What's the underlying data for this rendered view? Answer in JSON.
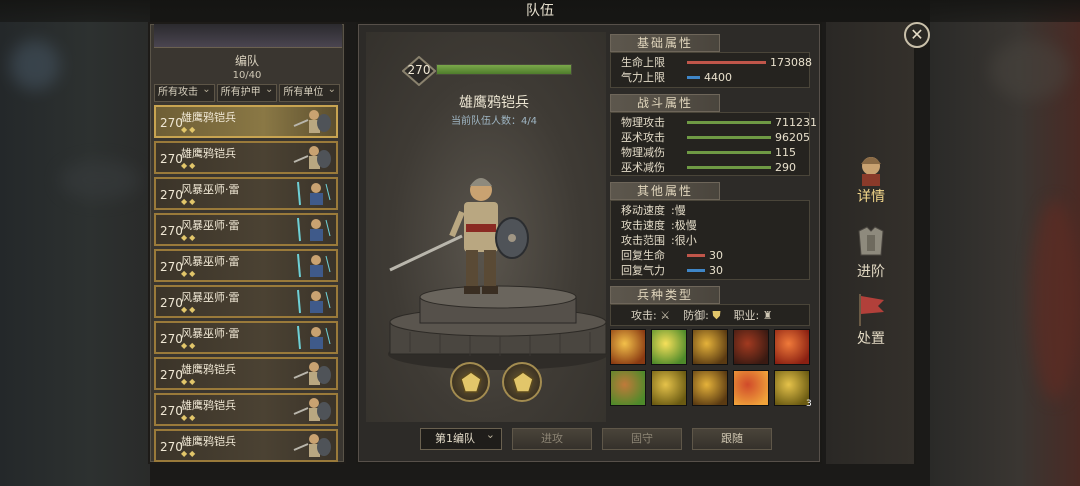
{
  "window": {
    "title": "队伍"
  },
  "roster": {
    "title": "编队",
    "count": "10/40",
    "filters": [
      "所有攻击",
      "所有护甲",
      "所有单位"
    ],
    "units": [
      {
        "level": "270",
        "name": "雄鹰鸦铠兵",
        "stars": "◆◆",
        "type": "shield",
        "selected": true
      },
      {
        "level": "270",
        "name": "雄鹰鸦铠兵",
        "stars": "◆◆",
        "type": "shield",
        "selected": false
      },
      {
        "level": "270",
        "name": "风暴巫师·雷",
        "stars": "◆◆",
        "type": "mage",
        "selected": false
      },
      {
        "level": "270",
        "name": "风暴巫师·雷",
        "stars": "◆◆",
        "type": "mage",
        "selected": false
      },
      {
        "level": "270",
        "name": "风暴巫师·雷",
        "stars": "◆◆",
        "type": "mage",
        "selected": false
      },
      {
        "level": "270",
        "name": "风暴巫师·雷",
        "stars": "◆◆",
        "type": "mage",
        "selected": false
      },
      {
        "level": "270",
        "name": "风暴巫师·雷",
        "stars": "◆◆",
        "type": "mage",
        "selected": false
      },
      {
        "level": "270",
        "name": "雄鹰鸦铠兵",
        "stars": "◆◆",
        "type": "shield",
        "selected": false
      },
      {
        "level": "270",
        "name": "雄鹰鸦铠兵",
        "stars": "◆◆",
        "type": "shield",
        "selected": false
      },
      {
        "level": "270",
        "name": "雄鹰鸦铠兵",
        "stars": "◆◆",
        "type": "shield",
        "selected": false
      }
    ]
  },
  "unit": {
    "level": "270",
    "name": "雄鹰鸦铠兵",
    "squad_count": "当前队伍人数：4/4",
    "exp_fraction": 1.0
  },
  "attributes": {
    "basic": {
      "title": "基础属性",
      "rows": [
        {
          "label": "生命上限",
          "value": "173088",
          "bar_color": "#c0564a",
          "fraction": 0.9
        },
        {
          "label": "气力上限",
          "value": "4400",
          "bar_color": "#3f86c7",
          "fraction": 0.15
        }
      ]
    },
    "combat": {
      "title": "战斗属性",
      "rows": [
        {
          "label": "物理攻击",
          "value": "711231",
          "bar_color": "#6f9a44",
          "fraction": 0.95
        },
        {
          "label": "巫术攻击",
          "value": "96205",
          "bar_color": "#6f9a44",
          "fraction": 0.95
        },
        {
          "label": "物理减伤",
          "value": "115",
          "bar_color": "#6f9a44",
          "fraction": 0.95
        },
        {
          "label": "巫术减伤",
          "value": "290",
          "bar_color": "#6f9a44",
          "fraction": 0.95
        }
      ]
    },
    "other": {
      "title": "其他属性",
      "rows": [
        {
          "label": "移动速度",
          "value": ":慢"
        },
        {
          "label": "攻击速度",
          "value": ":极慢"
        },
        {
          "label": "攻击范围",
          "value": ":很小"
        },
        {
          "label": "回复生命",
          "value": "30",
          "bar_color": "#c0564a",
          "fraction": 0.2
        },
        {
          "label": "回复气力",
          "value": "30",
          "bar_color": "#3f86c7",
          "fraction": 0.2
        }
      ]
    },
    "troop_type": {
      "title": "兵种类型",
      "attack_label": "攻击:",
      "defense_label": "防御:",
      "class_label": "职业:"
    }
  },
  "skills": [
    {
      "name": "skill-1",
      "colors": [
        "#f3c04a",
        "#8a3a12"
      ]
    },
    {
      "name": "skill-2",
      "colors": [
        "#f6e05a",
        "#4e8a2a"
      ]
    },
    {
      "name": "skill-3",
      "colors": [
        "#e5b23a",
        "#5a3a12"
      ]
    },
    {
      "name": "skill-4",
      "colors": [
        "#a23a20",
        "#3a1a12"
      ]
    },
    {
      "name": "skill-5",
      "colors": [
        "#f07a3a",
        "#8a2012"
      ]
    },
    {
      "name": "skill-6",
      "colors": [
        "#c07a3a",
        "#4e8a2a"
      ]
    },
    {
      "name": "skill-7",
      "colors": [
        "#e5c24a",
        "#6a5a12"
      ]
    },
    {
      "name": "skill-8",
      "colors": [
        "#e5b23a",
        "#5a3a12"
      ]
    },
    {
      "name": "skill-9",
      "colors": [
        "#d04a2a",
        "#f0a23a"
      ]
    },
    {
      "name": "skill-10",
      "colors": [
        "#e5c24a",
        "#6a5a12"
      ]
    }
  ],
  "skill_badge": "3",
  "commands": {
    "squad": "第1编队",
    "attack": "进攻",
    "defend": "固守",
    "follow": "跟随"
  },
  "side_tabs": [
    {
      "label": "详情",
      "icon": "helmet-icon",
      "active": true
    },
    {
      "label": "进阶",
      "icon": "armor-icon",
      "active": false
    },
    {
      "label": "处置",
      "icon": "flag-icon",
      "active": false
    }
  ],
  "colors": {
    "accent_gold": "#c8a451",
    "exp_green": "#6f9a44",
    "hp_red": "#c0564a",
    "mana_blue": "#3f86c7"
  }
}
